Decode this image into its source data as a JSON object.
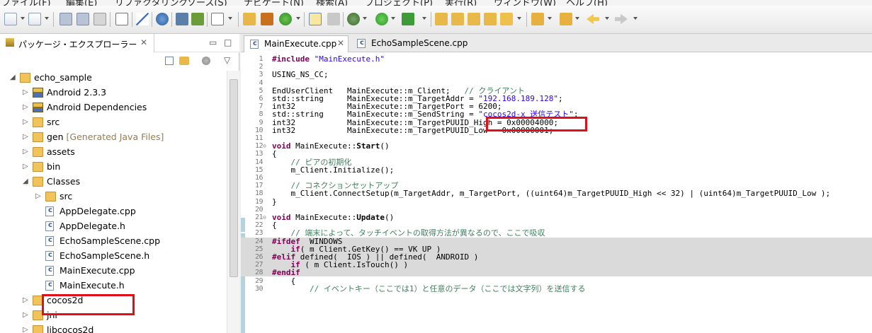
{
  "menubar": {
    "items": [
      "ファイル(F)",
      "編集(E)",
      "リファクタリング",
      "ソース(S)",
      "ナビゲート(N)",
      "検索(A)",
      "プロジェクト(P)",
      "実行(R)",
      "ウィンドウ(W)",
      "ヘルプ(H)"
    ]
  },
  "toolbar": {
    "icons": [
      "new-icon",
      "new-class-icon",
      "save-icon",
      "save-all-icon",
      "binary-icon",
      "pin-icon",
      "debug-config-icon",
      "build-icon",
      "console-icon",
      "checkbox-icon",
      "new-folder-icon",
      "refresh-icon",
      "mark-icon",
      "toggle-icon",
      "settings-icon",
      "run-icon",
      "external-tools-icon",
      "open-folder-icon",
      "search-icon",
      "open-icon",
      "open-2-icon",
      "annotation-icon",
      "next-annotation-icon",
      "prev-annotation-icon",
      "back-icon",
      "forward-icon"
    ]
  },
  "explorer": {
    "title": "パッケージ・エクスプローラー",
    "tree": [
      {
        "label": "echo_sample",
        "depth": 0,
        "twisty": "open",
        "icon": "project-icon"
      },
      {
        "label": "Android 2.3.3",
        "depth": 1,
        "twisty": "closed",
        "icon": "library-icon"
      },
      {
        "label": "Android Dependencies",
        "depth": 1,
        "twisty": "closed",
        "icon": "library-icon"
      },
      {
        "label": "src",
        "depth": 1,
        "twisty": "closed",
        "icon": "source-folder-icon"
      },
      {
        "label": "gen",
        "decoration": "[Generated Java Files]",
        "depth": 1,
        "twisty": "closed",
        "icon": "source-folder-icon"
      },
      {
        "label": "assets",
        "depth": 1,
        "twisty": "closed",
        "icon": "folder-icon"
      },
      {
        "label": "bin",
        "depth": 1,
        "twisty": "closed",
        "icon": "folder-icon"
      },
      {
        "label": "Classes",
        "depth": 1,
        "twisty": "open",
        "icon": "folder-icon"
      },
      {
        "label": "src",
        "depth": 2,
        "twisty": "closed",
        "icon": "folder-icon"
      },
      {
        "label": "AppDelegate.cpp",
        "depth": 2,
        "twisty": "",
        "icon": "cpp-file-icon"
      },
      {
        "label": "AppDelegate.h",
        "depth": 2,
        "twisty": "",
        "icon": "header-file-icon"
      },
      {
        "label": "EchoSampleScene.cpp",
        "depth": 2,
        "twisty": "",
        "icon": "cpp-file-icon"
      },
      {
        "label": "EchoSampleScene.h",
        "depth": 2,
        "twisty": "",
        "icon": "header-file-icon"
      },
      {
        "label": "MainExecute.cpp",
        "depth": 2,
        "twisty": "",
        "icon": "cpp-file-icon"
      },
      {
        "label": "MainExecute.h",
        "depth": 2,
        "twisty": "",
        "icon": "header-file-icon"
      },
      {
        "label": "cocos2d",
        "depth": 1,
        "twisty": "closed",
        "icon": "folder-icon"
      },
      {
        "label": "jni",
        "depth": 1,
        "twisty": "closed",
        "icon": "folder-icon"
      },
      {
        "label": "libcocos2d",
        "depth": 1,
        "twisty": "closed",
        "icon": "folder-icon"
      }
    ]
  },
  "editor": {
    "tabs": [
      {
        "label": "MainExecute.cpp",
        "active": true
      },
      {
        "label": "EchoSampleScene.cpp",
        "active": false
      }
    ],
    "lines": [
      {
        "n": "1",
        "html": "<span class=\"pp\">#include</span> <span class=\"str\">\"MainExecute.h\"</span>"
      },
      {
        "n": "2",
        "html": ""
      },
      {
        "n": "3",
        "html": "USING_NS_CC;"
      },
      {
        "n": "4",
        "html": ""
      },
      {
        "n": "5",
        "html": "EndUserClient   MainExecute::m_Client;   <span class=\"cm\">// クライアント</span>"
      },
      {
        "n": "6",
        "html": "std::string     MainExecute::m_TargetAddr = <span class=\"str\">\"192.168.189.128\"</span>;"
      },
      {
        "n": "7",
        "html": "int32           MainExecute::m_TargetPort = 6200;"
      },
      {
        "n": "8",
        "html": "std::string     MainExecute::m_SendString = <span class=\"str\">\"cocos2d-x 送信テスト\"</span>;"
      },
      {
        "n": "9",
        "html": "int32           MainExecute::m_TargetPUUID_High = 0x00004000;"
      },
      {
        "n": "10",
        "html": "int32           MainExecute::m_TargetPUUID_Low = 0x00000001;"
      },
      {
        "n": "11",
        "html": ""
      },
      {
        "n": "12",
        "fold": true,
        "html": "<span class=\"kw\">void</span> MainExecute::<span class=\"fn\">Start</span>()"
      },
      {
        "n": "13",
        "html": "{"
      },
      {
        "n": "14",
        "html": "    <span class=\"cm\">// ピアの初期化</span>"
      },
      {
        "n": "15",
        "html": "    m_Client.Initialize();"
      },
      {
        "n": "16",
        "html": ""
      },
      {
        "n": "17",
        "html": "    <span class=\"cm\">// コネクションセットアップ</span>"
      },
      {
        "n": "18",
        "html": "    m_Client.ConnectSetup(m_TargetAddr, m_TargetPort, ((uint64)m_TargetPUUID_High << 32) | (uint64)m_TargetPUUID_Low );"
      },
      {
        "n": "19",
        "html": "}"
      },
      {
        "n": "20",
        "html": ""
      },
      {
        "n": "21",
        "fold": true,
        "html": "<span class=\"kw\">void</span> MainExecute::<span class=\"fn\">Update</span>()"
      },
      {
        "n": "22",
        "html": "{"
      },
      {
        "n": "23",
        "html": "    <span class=\"cm\">// 端末によって、タッチイベントの取得方法が異なるので、ここで吸収</span>"
      },
      {
        "n": "24",
        "hl": true,
        "html": "<span class=\"pp\">#ifdef</span> _WINDOWS"
      },
      {
        "n": "25",
        "hl": true,
        "html": "    <span class=\"kw\">if</span>( m_Client.GetKey() == VK_UP )"
      },
      {
        "n": "26",
        "hl": true,
        "html": "<span class=\"pp\">#elif</span> defined( _IOS ) || defined( _ANDROID )"
      },
      {
        "n": "27",
        "hl": true,
        "html": "    <span class=\"kw\">if</span> ( m_Client.IsTouch() )"
      },
      {
        "n": "28",
        "hl": true,
        "html": "<span class=\"pp\">#endif</span>"
      },
      {
        "n": "29",
        "html": "    {"
      },
      {
        "n": "30",
        "html": "        <span class=\"cm\">// イベントキー（ここでは1）と任意のデータ（ここでは文字列）を送信する</span>"
      }
    ]
  }
}
